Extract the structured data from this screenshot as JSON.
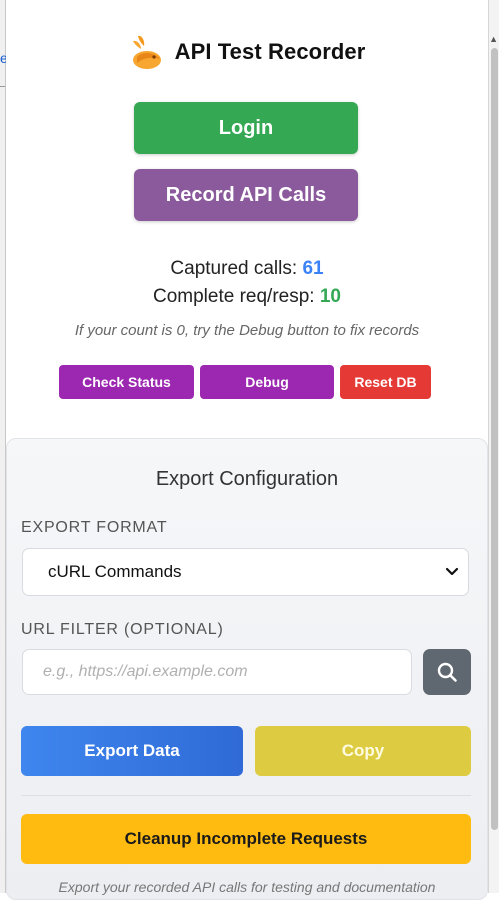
{
  "header": {
    "title": "API Test Recorder",
    "logo_icon": "rabbit-logo-icon"
  },
  "actions": {
    "login_label": "Login",
    "record_label": "Record API Calls"
  },
  "stats": {
    "captured_label": "Captured calls:",
    "captured_value": "61",
    "complete_label": "Complete req/resp:",
    "complete_value": "10",
    "hint": "If your count is 0, try the Debug button to fix records"
  },
  "tools": {
    "check_status": "Check Status",
    "debug": "Debug",
    "reset_db": "Reset DB"
  },
  "export": {
    "title": "Export Configuration",
    "format_label": "EXPORT FORMAT",
    "format_value": "cURL Commands",
    "filter_label": "URL FILTER (OPTIONAL)",
    "filter_placeholder": "e.g., https://api.example.com",
    "export_label": "Export Data",
    "copy_label": "Copy",
    "cleanup_label": "Cleanup Incomplete Requests",
    "footer": "Export your recorded API calls for testing and documentation"
  },
  "colors": {
    "login": "#34a853",
    "record": "#8b5a9c",
    "purple": "#9c27b0",
    "reset": "#e53935",
    "export": "#3f86ef",
    "copy": "#ddcc42",
    "cleanup": "#ffbb0f"
  },
  "background_page": {
    "left_fragment": "e"
  }
}
